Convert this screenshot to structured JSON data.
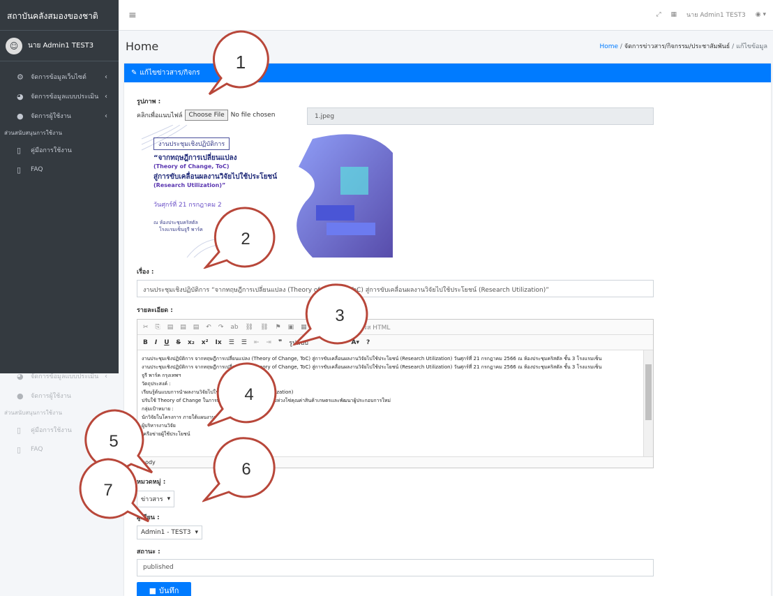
{
  "app": {
    "brand": "สถาบันคลังสมองของชาติ"
  },
  "user": {
    "name": "นาย Admin1 TEST3",
    "topbar_name": "นาย Admin1 TEST3"
  },
  "sidebar": {
    "items": [
      {
        "label": "จัดการข้อมูลเว็บไซต์",
        "icon": "cogs-icon"
      },
      {
        "label": "จัดการข้อมูลแบบประเมิน",
        "icon": "dashboard-icon"
      },
      {
        "label": "จัดการผู้ใช้งาน",
        "icon": "user-icon"
      }
    ],
    "header": "ส่วนสนับสนุนการใช้งาน",
    "support": [
      {
        "label": "คู่มือการใช้งาน",
        "icon": "file-icon"
      },
      {
        "label": "FAQ",
        "icon": "file-icon"
      }
    ]
  },
  "page": {
    "title": "Home"
  },
  "breadcrumb": {
    "home": "Home",
    "section": "จัดการข่าวสาร/กิจกรรม/ประชาสัมพันธ์",
    "current": "แก้ไขข้อมูล"
  },
  "card": {
    "title": "แก้ไขข่าวสาร/กิจกร"
  },
  "form": {
    "image_label": "รูปภาพ :",
    "file_prompt": "คลิกเพื่อแนบไฟล์",
    "choose_file": "Choose File",
    "no_file": "No file chosen",
    "current_file": "1.jpeg",
    "title_label": "เรื่อง :",
    "title_value": "งานประชุมเชิงปฏิบัติการ “จากทฤษฎีการเปลี่ยนแปลง (Theory of Change, ToC) สู่การขับเคลื่อนผลงานวิจัยไปใช้ประโยชน์ (Research Utilization)”",
    "detail_label": "รายละเอียด :",
    "editor_path": "body",
    "editor_lines": [
      "งานประชุมเชิงปฏิบัติการ จากทฤษฎีการเปลี่ยนแปลง (Theory of Change, ToC) สู่การขับเคลื่อนผลงานวิจัยไปใช้ประโยชน์ (Research Utilization) วันศุกร์ที่ 21 กรกฎาคม 2566 ณ ห้องประชุมคริสตัล ชั้น 3 โรงแรมเซ็น",
      "งานประชุมเชิงปฏิบัติการ จากทฤษฎีการเปลี่ยนแปลง (Theory of Change, ToC) สู่การขับเคลื่อนผลงานวิจัยไปใช้ประโยชน์ (Research Utilization) วันศุกร์ที่ 21 กรกฎาคม 2566 ณ ห้องประชุมคริสตัล ชั้น 3 โรงแรมเซ็น",
      "จูรี พาร์ค กรุงเทพฯ",
      "วัตถุประสงค์ :",
      "เรียนรู้ต้นแบบการนำผลงานวิจัยไปใช้ประโยชน์ (Research Utilization)",
      "ปรับใช้ Theory of Change ในการพัฒนานวัตกรรมการยกระดับห่วงโซ่คุณค่าสินค้าเกษตรและพัฒนาผู้ประกอบการใหม่",
      "กลุ่มเป้าหมาย :",
      "นักวิจัยในโครงการ ภายใต้แผนงาน",
      "ผู้บริหารงานวิจัย",
      "เครือข่ายผู้ใช้ประโยชน์"
    ],
    "category_label": "หมวดหมู่ :",
    "category_value": "ข่าวสาร",
    "author_label": "ผู้เขียน :",
    "author_value": "Admin1 - TEST3",
    "status_label": "สถานะ :",
    "status_value": "published",
    "save": "บันทึก"
  },
  "editor_toolbar": {
    "source": "ซอร์ส HTML",
    "format": "รูปแบบ"
  },
  "poster": {
    "tag": "งานประชุมเชิงปฏิบัติการ",
    "line1": "“จากทฤษฎีการเปลี่ยนแปลง",
    "line2": "(Theory of Change, ToC)",
    "line3": "สู่การขับเคลื่อนผลงานวิจัยไปใช้ประโยชน์",
    "line4": "(Research Utilization)”",
    "date": "วันศุกร์ที่ 21 กรกฎาคม 2",
    "venue1": "ณ ห้องประชุมคริสตัล",
    "venue2": "โรงแรมเซ็นจูรี พาร์ค"
  },
  "callouts": [
    "1",
    "2",
    "3",
    "4",
    "5",
    "6",
    "7"
  ],
  "colors": {
    "primary": "#007bff",
    "sidebar": "#343a40",
    "callout": "#b8473a"
  }
}
